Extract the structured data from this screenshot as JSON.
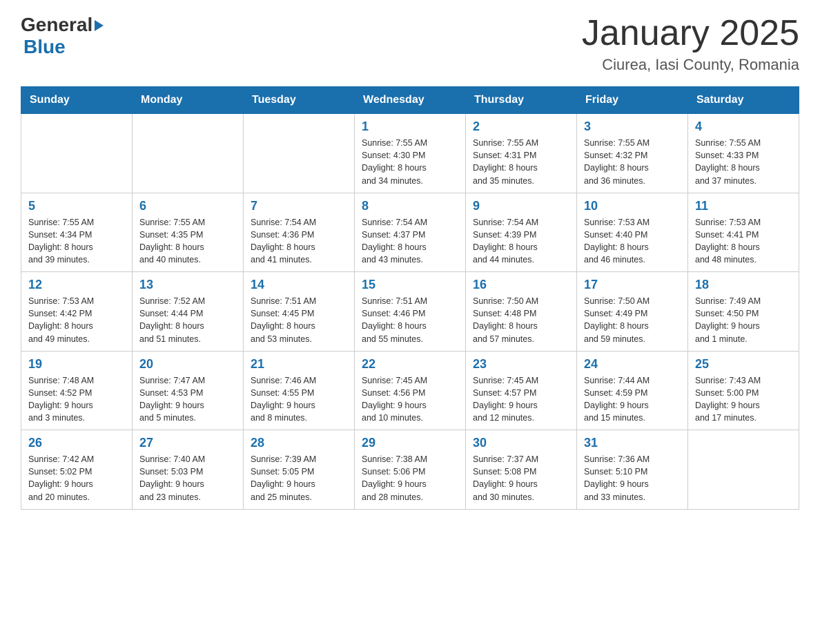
{
  "header": {
    "logo_line1": "General",
    "logo_line2": "Blue",
    "month_title": "January 2025",
    "location": "Ciurea, Iasi County, Romania"
  },
  "weekdays": [
    "Sunday",
    "Monday",
    "Tuesday",
    "Wednesday",
    "Thursday",
    "Friday",
    "Saturday"
  ],
  "weeks": [
    [
      {
        "day": "",
        "info": ""
      },
      {
        "day": "",
        "info": ""
      },
      {
        "day": "",
        "info": ""
      },
      {
        "day": "1",
        "info": "Sunrise: 7:55 AM\nSunset: 4:30 PM\nDaylight: 8 hours\nand 34 minutes."
      },
      {
        "day": "2",
        "info": "Sunrise: 7:55 AM\nSunset: 4:31 PM\nDaylight: 8 hours\nand 35 minutes."
      },
      {
        "day": "3",
        "info": "Sunrise: 7:55 AM\nSunset: 4:32 PM\nDaylight: 8 hours\nand 36 minutes."
      },
      {
        "day": "4",
        "info": "Sunrise: 7:55 AM\nSunset: 4:33 PM\nDaylight: 8 hours\nand 37 minutes."
      }
    ],
    [
      {
        "day": "5",
        "info": "Sunrise: 7:55 AM\nSunset: 4:34 PM\nDaylight: 8 hours\nand 39 minutes."
      },
      {
        "day": "6",
        "info": "Sunrise: 7:55 AM\nSunset: 4:35 PM\nDaylight: 8 hours\nand 40 minutes."
      },
      {
        "day": "7",
        "info": "Sunrise: 7:54 AM\nSunset: 4:36 PM\nDaylight: 8 hours\nand 41 minutes."
      },
      {
        "day": "8",
        "info": "Sunrise: 7:54 AM\nSunset: 4:37 PM\nDaylight: 8 hours\nand 43 minutes."
      },
      {
        "day": "9",
        "info": "Sunrise: 7:54 AM\nSunset: 4:39 PM\nDaylight: 8 hours\nand 44 minutes."
      },
      {
        "day": "10",
        "info": "Sunrise: 7:53 AM\nSunset: 4:40 PM\nDaylight: 8 hours\nand 46 minutes."
      },
      {
        "day": "11",
        "info": "Sunrise: 7:53 AM\nSunset: 4:41 PM\nDaylight: 8 hours\nand 48 minutes."
      }
    ],
    [
      {
        "day": "12",
        "info": "Sunrise: 7:53 AM\nSunset: 4:42 PM\nDaylight: 8 hours\nand 49 minutes."
      },
      {
        "day": "13",
        "info": "Sunrise: 7:52 AM\nSunset: 4:44 PM\nDaylight: 8 hours\nand 51 minutes."
      },
      {
        "day": "14",
        "info": "Sunrise: 7:51 AM\nSunset: 4:45 PM\nDaylight: 8 hours\nand 53 minutes."
      },
      {
        "day": "15",
        "info": "Sunrise: 7:51 AM\nSunset: 4:46 PM\nDaylight: 8 hours\nand 55 minutes."
      },
      {
        "day": "16",
        "info": "Sunrise: 7:50 AM\nSunset: 4:48 PM\nDaylight: 8 hours\nand 57 minutes."
      },
      {
        "day": "17",
        "info": "Sunrise: 7:50 AM\nSunset: 4:49 PM\nDaylight: 8 hours\nand 59 minutes."
      },
      {
        "day": "18",
        "info": "Sunrise: 7:49 AM\nSunset: 4:50 PM\nDaylight: 9 hours\nand 1 minute."
      }
    ],
    [
      {
        "day": "19",
        "info": "Sunrise: 7:48 AM\nSunset: 4:52 PM\nDaylight: 9 hours\nand 3 minutes."
      },
      {
        "day": "20",
        "info": "Sunrise: 7:47 AM\nSunset: 4:53 PM\nDaylight: 9 hours\nand 5 minutes."
      },
      {
        "day": "21",
        "info": "Sunrise: 7:46 AM\nSunset: 4:55 PM\nDaylight: 9 hours\nand 8 minutes."
      },
      {
        "day": "22",
        "info": "Sunrise: 7:45 AM\nSunset: 4:56 PM\nDaylight: 9 hours\nand 10 minutes."
      },
      {
        "day": "23",
        "info": "Sunrise: 7:45 AM\nSunset: 4:57 PM\nDaylight: 9 hours\nand 12 minutes."
      },
      {
        "day": "24",
        "info": "Sunrise: 7:44 AM\nSunset: 4:59 PM\nDaylight: 9 hours\nand 15 minutes."
      },
      {
        "day": "25",
        "info": "Sunrise: 7:43 AM\nSunset: 5:00 PM\nDaylight: 9 hours\nand 17 minutes."
      }
    ],
    [
      {
        "day": "26",
        "info": "Sunrise: 7:42 AM\nSunset: 5:02 PM\nDaylight: 9 hours\nand 20 minutes."
      },
      {
        "day": "27",
        "info": "Sunrise: 7:40 AM\nSunset: 5:03 PM\nDaylight: 9 hours\nand 23 minutes."
      },
      {
        "day": "28",
        "info": "Sunrise: 7:39 AM\nSunset: 5:05 PM\nDaylight: 9 hours\nand 25 minutes."
      },
      {
        "day": "29",
        "info": "Sunrise: 7:38 AM\nSunset: 5:06 PM\nDaylight: 9 hours\nand 28 minutes."
      },
      {
        "day": "30",
        "info": "Sunrise: 7:37 AM\nSunset: 5:08 PM\nDaylight: 9 hours\nand 30 minutes."
      },
      {
        "day": "31",
        "info": "Sunrise: 7:36 AM\nSunset: 5:10 PM\nDaylight: 9 hours\nand 33 minutes."
      },
      {
        "day": "",
        "info": ""
      }
    ]
  ]
}
